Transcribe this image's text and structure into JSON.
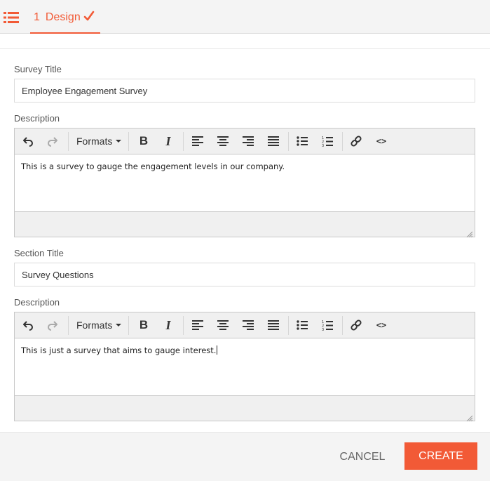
{
  "header": {
    "menu_icon": "list-icon",
    "tab": {
      "number": "1",
      "label": "Design",
      "status_icon": "check-icon"
    }
  },
  "form": {
    "survey_title": {
      "label": "Survey Title",
      "value": "Employee Engagement Survey"
    },
    "description_1": {
      "label": "Description",
      "content": "This is a survey to gauge the engagement levels in our company."
    },
    "section_title": {
      "label": "Section Title",
      "value": "Survey Questions"
    },
    "description_2": {
      "label": "Description",
      "content": "This is just a survey that aims to gauge interest."
    }
  },
  "toolbar": {
    "formats_label": "Formats"
  },
  "footer": {
    "cancel_label": "CANCEL",
    "create_label": "CREATE"
  },
  "colors": {
    "accent": "#f25a36",
    "toolbar_bg": "#f0f0f0",
    "border": "#c8c8c8"
  }
}
